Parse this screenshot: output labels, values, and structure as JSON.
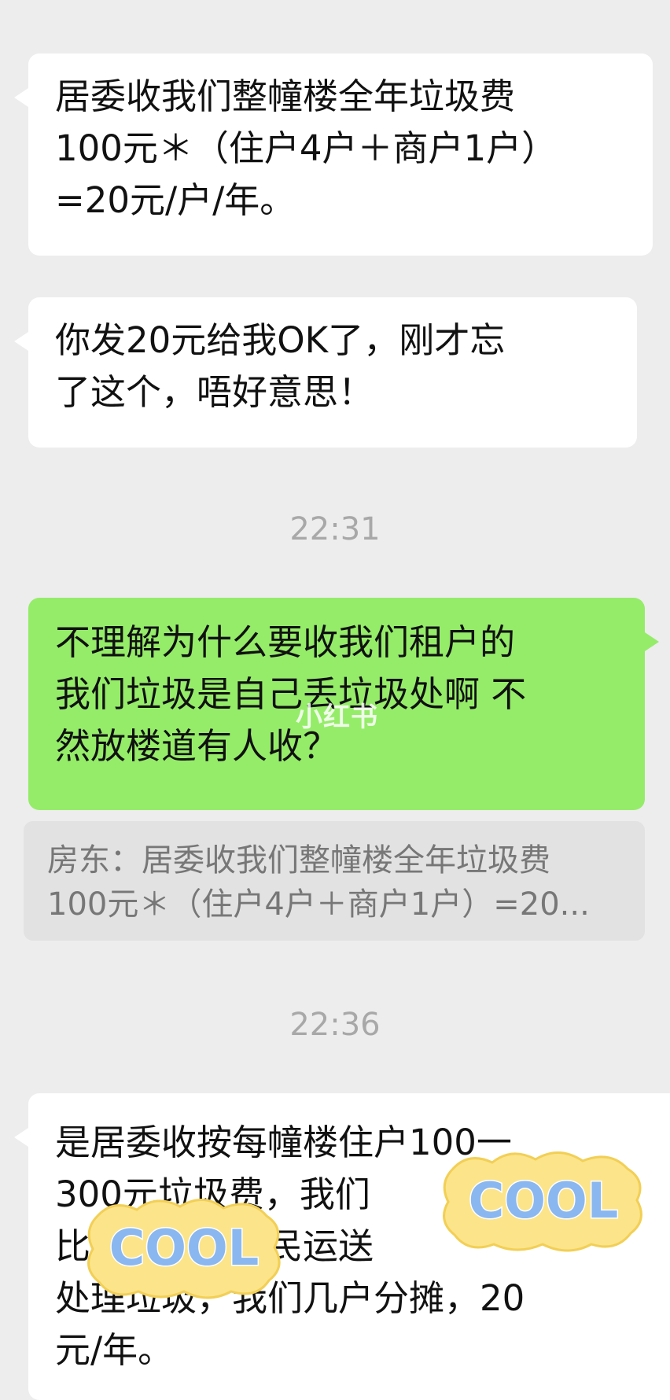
{
  "messages": [
    {
      "text": "居委收我们整幢楼全年垃圾费\n100元＊（住户4户＋商户1户）\n=20元/户/年。"
    },
    {
      "text": "你发20元给我OK了，刚才忘\n了这个，唔好意思！"
    },
    {
      "time": "22:31"
    },
    {
      "text": "不理解为什么要收我们租户的\n我们垃圾是自己丢垃圾处啊 不\n然放楼道有人收？"
    },
    {
      "quote": "房东：居委收我们整幢楼全年垃圾费\n100元＊（住户4户＋商户1户）=20..."
    },
    {
      "time": "22:36"
    },
    {
      "text": "是居委收按每幢楼住户100一\n300元垃圾费，我们\n比收，是帮居民运送\n处理垃圾，我们几户分摊，20\n元/年。"
    }
  ],
  "watermark": "小红书",
  "stickers": [
    "COOL",
    "COOL"
  ],
  "colors": {
    "background": "#ededed",
    "incoming": "#ffffff",
    "outgoing": "#95ec69"
  }
}
